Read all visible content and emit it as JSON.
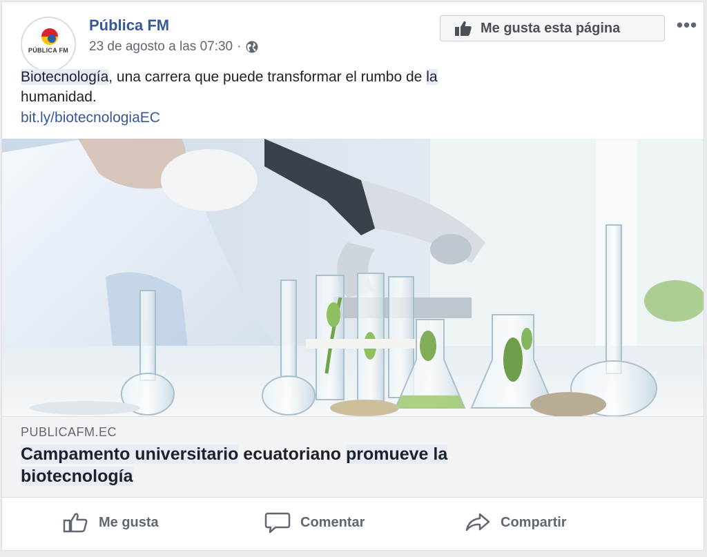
{
  "page": {
    "name": "Pública FM",
    "timestamp": "23 de agosto a las 07:30",
    "separator": "·",
    "logo_text": "PÚBLICA FM",
    "like_page_label": "Me gusta esta página",
    "more_label": "•••"
  },
  "post": {
    "text_keyword": "Biotecnología",
    "text_middle": ", una carrera que puede transformar el rumbo de ",
    "text_la": "la",
    "text_end": "humanidad.",
    "link": "bit.ly/biotecnologiaEC"
  },
  "preview": {
    "domain": "PUBLICAFM.EC",
    "headline_part1": "Campamento universitario",
    "headline_part2": " ecuatoriano ",
    "headline_part3": "promueve la",
    "headline_part4": "biotecnología"
  },
  "actions": {
    "like": "Me gusta",
    "comment": "Comentar",
    "share": "Compartir"
  },
  "colors": {
    "brand": "#365899",
    "highlight": "#e7ecf7",
    "logo_red": "#d8232a",
    "logo_yellow": "#f5c400",
    "logo_blue": "#2b5fae"
  },
  "icons": [
    "globe-icon",
    "thumbs-up-icon",
    "more-icon",
    "like-outline-icon",
    "comment-icon",
    "share-icon"
  ]
}
